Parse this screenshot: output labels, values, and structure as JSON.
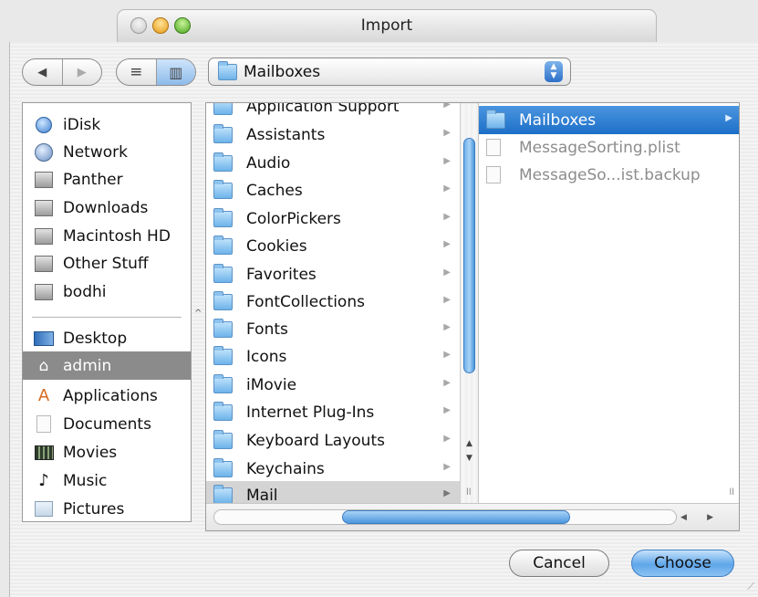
{
  "window": {
    "title": "Import"
  },
  "toolbar": {
    "back_symbol": "◀",
    "forward_symbol": "▶",
    "list_view_symbol": "≡",
    "column_view_symbol": "▥",
    "location": "Mailboxes"
  },
  "sidebar": {
    "devices": [
      {
        "label": "iDisk",
        "icon": "idisk-icon"
      },
      {
        "label": "Network",
        "icon": "network-globe-icon"
      },
      {
        "label": "Panther",
        "icon": "hard-drive-icon"
      },
      {
        "label": "Downloads",
        "icon": "hard-drive-icon"
      },
      {
        "label": "Macintosh HD",
        "icon": "hard-drive-icon"
      },
      {
        "label": "Other Stuff",
        "icon": "hard-drive-icon"
      },
      {
        "label": "bodhi",
        "icon": "hard-drive-icon"
      }
    ],
    "places": [
      {
        "label": "Desktop",
        "icon": "desktop-icon"
      },
      {
        "label": "admin",
        "icon": "home-icon",
        "selected": true
      },
      {
        "label": "Applications",
        "icon": "applications-icon"
      },
      {
        "label": "Documents",
        "icon": "documents-icon"
      },
      {
        "label": "Movies",
        "icon": "movies-icon"
      },
      {
        "label": "Music",
        "icon": "music-icon"
      },
      {
        "label": "Pictures",
        "icon": "pictures-icon"
      }
    ]
  },
  "column1": {
    "items": [
      {
        "label": "Application Support"
      },
      {
        "label": "Assistants"
      },
      {
        "label": "Audio"
      },
      {
        "label": "Caches"
      },
      {
        "label": "ColorPickers"
      },
      {
        "label": "Cookies"
      },
      {
        "label": "Favorites"
      },
      {
        "label": "FontCollections"
      },
      {
        "label": "Fonts"
      },
      {
        "label": "Icons"
      },
      {
        "label": "iMovie"
      },
      {
        "label": "Internet Plug-Ins"
      },
      {
        "label": "Keyboard Layouts"
      },
      {
        "label": "Keychains"
      },
      {
        "label": "Mail",
        "selected": true
      }
    ]
  },
  "column2": {
    "items": [
      {
        "label": "Mailboxes",
        "type": "folder",
        "selected": true
      },
      {
        "label": "MessageSorting.plist",
        "type": "file"
      },
      {
        "label": "MessageSo...ist.backup",
        "type": "file"
      }
    ]
  },
  "buttons": {
    "cancel": "Cancel",
    "choose": "Choose"
  },
  "colors": {
    "selection_blue": "#2a7ad2",
    "default_button": "#5fa6ea",
    "sidebar_selected": "#8b8b8b"
  }
}
